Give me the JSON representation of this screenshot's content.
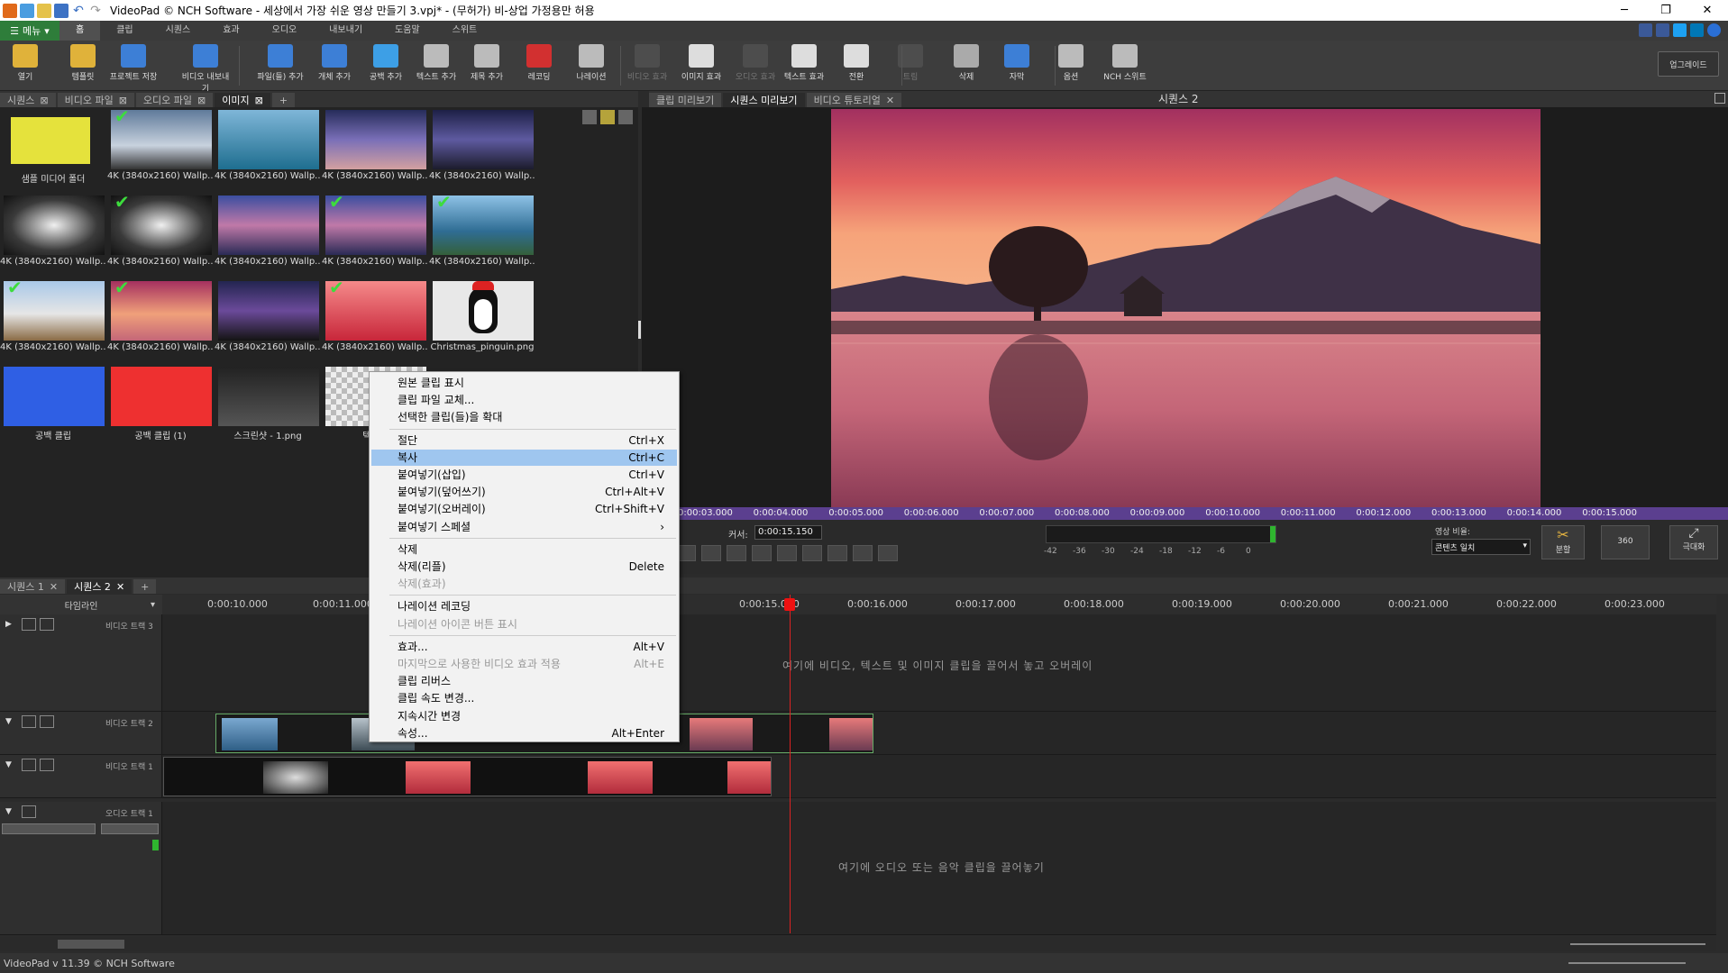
{
  "window": {
    "title": "VideoPad © NCH Software - 세상에서 가장 쉬운 영상 만들기 3.vpj* - (무허가) 비-상업 가정용만 허용",
    "controls": [
      "─",
      "❐",
      "✕"
    ]
  },
  "menubar": {
    "menu_button": "메뉴",
    "tabs": [
      "홈",
      "클립",
      "시퀀스",
      "효과",
      "오디오",
      "내보내기",
      "도움말",
      "스위트"
    ],
    "active_tab": "홈"
  },
  "toolbar": {
    "buttons": [
      {
        "label": "열기",
        "icon": "folder-open-icon",
        "enabled": true
      },
      {
        "label": "템플릿",
        "icon": "template-icon",
        "enabled": true
      },
      {
        "label": "프로젝트 저장",
        "icon": "save-icon",
        "enabled": true
      },
      {
        "label": "비디오 내보내기",
        "icon": "export-video-icon",
        "enabled": true
      },
      {
        "label": "파일(들) 추가",
        "icon": "add-files-icon",
        "enabled": true
      },
      {
        "label": "개체 추가",
        "icon": "add-object-icon",
        "enabled": true
      },
      {
        "label": "공백 추가",
        "icon": "add-blank-icon",
        "enabled": true
      },
      {
        "label": "텍스트 추가",
        "icon": "add-text-icon",
        "enabled": true
      },
      {
        "label": "제목 추가",
        "icon": "add-title-icon",
        "enabled": true
      },
      {
        "label": "레코딩",
        "icon": "record-icon",
        "enabled": true
      },
      {
        "label": "나레이션",
        "icon": "microphone-icon",
        "enabled": true
      },
      {
        "label": "비디오 효과",
        "icon": "video-fx-icon",
        "enabled": false
      },
      {
        "label": "이미지 효과",
        "icon": "image-fx-icon",
        "enabled": true
      },
      {
        "label": "오디오 효과",
        "icon": "audio-fx-icon",
        "enabled": false
      },
      {
        "label": "텍스트 효과",
        "icon": "text-fx-icon",
        "enabled": true
      },
      {
        "label": "전환",
        "icon": "transition-icon",
        "enabled": true
      },
      {
        "label": "트림",
        "icon": "trim-icon",
        "enabled": false
      },
      {
        "label": "삭제",
        "icon": "trash-icon",
        "enabled": true
      },
      {
        "label": "자막",
        "icon": "subtitle-icon",
        "enabled": true
      },
      {
        "label": "옵션",
        "icon": "options-icon",
        "enabled": true
      },
      {
        "label": "NCH 스위트",
        "icon": "nch-suite-icon",
        "enabled": true
      }
    ],
    "upgrade_label": "업그레이드"
  },
  "media_panel": {
    "tabs": [
      "시퀀스",
      "비디오 파일",
      "오디오 파일",
      "이미지"
    ],
    "active_tab": "이미지",
    "items": [
      {
        "label": "샘플 미디어 폴더",
        "kind": "folder",
        "checked": false
      },
      {
        "label": "4K (3840x2160) Wallp...",
        "kind": "clouds",
        "checked": true
      },
      {
        "label": "4K (3840x2160) Wallp...",
        "kind": "rock-sea",
        "checked": false
      },
      {
        "label": "4K (3840x2160) Wallp...",
        "kind": "milkyway",
        "checked": false
      },
      {
        "label": "4K (3840x2160) Wallp...",
        "kind": "milkyway2",
        "checked": false
      },
      {
        "label": "4K (3840x2160) Wallp...",
        "kind": "tunnel",
        "checked": false
      },
      {
        "label": "4K (3840x2160) Wallp...",
        "kind": "tunnel",
        "checked": true
      },
      {
        "label": "4K (3840x2160) Wallp...",
        "kind": "lake-dusk",
        "checked": false
      },
      {
        "label": "4K (3840x2160) Wallp...",
        "kind": "lake-dusk",
        "checked": true
      },
      {
        "label": "4K (3840x2160) Wallp...",
        "kind": "coast",
        "checked": true
      },
      {
        "label": "4K (3840x2160) Wallp...",
        "kind": "field",
        "checked": true
      },
      {
        "label": "4K (3840x2160) Wallp...",
        "kind": "sunset-lake",
        "checked": true
      },
      {
        "label": "4K (3840x2160) Wallp...",
        "kind": "night-road",
        "checked": false
      },
      {
        "label": "4K (3840x2160) Wallp...",
        "kind": "red-flowers",
        "checked": true
      },
      {
        "label": "Christmas_pinguin.png",
        "kind": "penguin",
        "checked": false
      },
      {
        "label": "공백 클립",
        "kind": "blue",
        "checked": false
      },
      {
        "label": "공백 클립 (1)",
        "kind": "red",
        "checked": false
      },
      {
        "label": "스크린샷 - 1.png",
        "kind": "screenshot",
        "checked": false
      },
      {
        "label": "텍스트",
        "kind": "text",
        "checked": false
      }
    ]
  },
  "preview": {
    "tabs": [
      "클립 미리보기",
      "시퀀스 미리보기",
      "비디오 튜토리얼"
    ],
    "active_tab": "시퀀스 미리보기",
    "sequence_name": "시퀀스 2",
    "ruler_ticks": [
      "2.000",
      "0:00:03.000",
      "0:00:04.000",
      "0:00:05.000",
      "0:00:06.000",
      "0:00:07.000",
      "0:00:08.000",
      "0:00:09.000",
      "0:00:10.000",
      "0:00:11.000",
      "0:00:12.000",
      "0:00:13.000",
      "0:00:14.000",
      "0:00:15.000"
    ],
    "cursor_label": "커서:",
    "cursor_value": "0:00:15.150",
    "meter_labels": [
      "-42",
      "-36",
      "-30",
      "-24",
      "-18",
      "-12",
      "-6",
      "0"
    ],
    "aspect_label": "영상 비율:",
    "aspect_value": "콘텐츠 일치",
    "split_label": "분할",
    "vr_label": "360",
    "fullscreen_label": "극대화"
  },
  "timeline": {
    "tabs": [
      "시퀀스 1",
      "시퀀스 2"
    ],
    "active_tab": "시퀀스 2",
    "header_label": "타임라인",
    "ruler_ticks": [
      "0:00:10.000",
      "0:00:11.000",
      "0:00:15.000",
      "0:00:16.000",
      "0:00:17.000",
      "0:00:18.000",
      "0:00:19.000",
      "0:00:20.000",
      "0:00:21.000",
      "0:00:22.000",
      "0:00:23.000"
    ],
    "tracks": {
      "video3": "비디오 트랙 3",
      "video2": "비디오 트랙 2",
      "video1": "비디오 트랙 1",
      "audio1": "오디오 트랙 1"
    },
    "video_hint": "여기에 비디오, 텍스트 및 이미지 클립을 끌어서 놓고 오버레이",
    "audio_hint": "여기에 오디오 또는 음악 클립을 끌어놓기"
  },
  "context_menu": {
    "items": [
      {
        "label": "원본 클립 표시",
        "shortcut": "",
        "enabled": true
      },
      {
        "label": "클립 파일 교체...",
        "shortcut": "",
        "enabled": true
      },
      {
        "label": "선택한 클립(들)을 확대",
        "shortcut": "",
        "enabled": true
      },
      {
        "sep": true
      },
      {
        "label": "절단",
        "shortcut": "Ctrl+X",
        "enabled": true
      },
      {
        "label": "복사",
        "shortcut": "Ctrl+C",
        "enabled": true,
        "highlight": true
      },
      {
        "label": "붙여넣기(삽입)",
        "shortcut": "Ctrl+V",
        "enabled": true
      },
      {
        "label": "붙여넣기(덮어쓰기)",
        "shortcut": "Ctrl+Alt+V",
        "enabled": true
      },
      {
        "label": "붙여넣기(오버레이)",
        "shortcut": "Ctrl+Shift+V",
        "enabled": true
      },
      {
        "label": "붙여넣기 스페셜",
        "shortcut": "›",
        "enabled": true
      },
      {
        "sep": true
      },
      {
        "label": "삭제",
        "shortcut": "",
        "enabled": true
      },
      {
        "label": "삭제(리플)",
        "shortcut": "Delete",
        "enabled": true
      },
      {
        "label": "삭제(효과)",
        "shortcut": "",
        "enabled": false
      },
      {
        "sep": true
      },
      {
        "label": "나레이션 레코딩",
        "shortcut": "",
        "enabled": true
      },
      {
        "label": "나레이션 아이콘 버튼 표시",
        "shortcut": "",
        "enabled": false
      },
      {
        "sep": true
      },
      {
        "label": "효과...",
        "shortcut": "Alt+V",
        "enabled": true
      },
      {
        "label": "마지막으로 사용한 비디오 효과 적용",
        "shortcut": "Alt+E",
        "enabled": false
      },
      {
        "label": "클립 리버스",
        "shortcut": "",
        "enabled": true
      },
      {
        "label": "클립 속도 변경...",
        "shortcut": "",
        "enabled": true
      },
      {
        "label": "지속시간 변경",
        "shortcut": "",
        "enabled": true
      },
      {
        "label": "속성...",
        "shortcut": "Alt+Enter",
        "enabled": true
      }
    ]
  },
  "status": {
    "text": "VideoPad v 11.39 © NCH Software"
  },
  "colors": {
    "accent_green": "#2e7d3a",
    "ruler_purple": "#5b3f8f",
    "playhead_red": "#dd1111",
    "menu_highlight": "#9fc6ef"
  }
}
